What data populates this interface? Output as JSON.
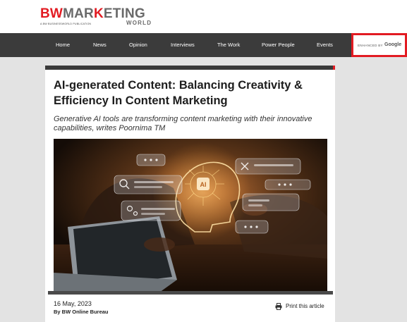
{
  "logo": {
    "brand_bw": "BW",
    "brand_mar": "MAR",
    "brand_k": "K",
    "brand_eting": "ETING",
    "brand_world": "WORLD",
    "publication_line": "A BW BUSINESSWORLD PUBLICATION"
  },
  "nav": {
    "items": [
      {
        "label": "Home"
      },
      {
        "label": "News"
      },
      {
        "label": "Opinion"
      },
      {
        "label": "Interviews"
      },
      {
        "label": "The Work"
      },
      {
        "label": "Power People"
      },
      {
        "label": "Events"
      }
    ]
  },
  "search": {
    "enhanced_by": "ENHANCED BY",
    "provider": "Google"
  },
  "article": {
    "title": "AI-generated Content: Balancing Creativity & Efficiency In Content Marketing",
    "subtitle": "Generative AI tools are transforming content marketing with their innovative capabilities, writes Poornima TM",
    "hero_chip_label": "AI",
    "date": "16 May, 2023",
    "byline": "By BW Online Bureau",
    "print_label": "Print this article"
  },
  "colors": {
    "brand_red": "#e21b22",
    "nav_bg": "#3b3b3b",
    "page_bg": "#e3e3e3"
  },
  "icons": {
    "print": "printer-icon",
    "hero_search": "magnifier-icon",
    "hero_gear": "gears-icon",
    "hero_tools": "tools-icon"
  }
}
